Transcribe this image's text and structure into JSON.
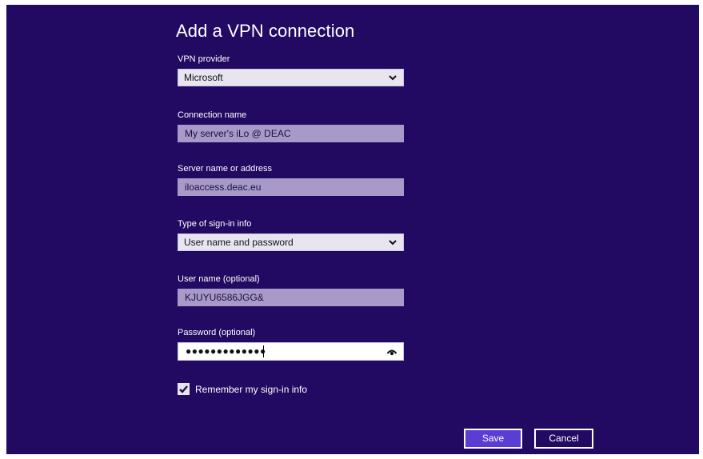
{
  "dialog": {
    "title": "Add a VPN connection",
    "vpn_provider": {
      "label": "VPN provider",
      "value": "Microsoft"
    },
    "connection_name": {
      "label": "Connection name",
      "value": "My server's iLo @ DEAC"
    },
    "server": {
      "label": "Server name or address",
      "value": "iloaccess.deac.eu"
    },
    "sign_in_type": {
      "label": "Type of sign-in info",
      "value": "User name and password"
    },
    "username": {
      "label": "User name (optional)",
      "value": "KJUYU6586JGG&"
    },
    "password": {
      "label": "Password (optional)",
      "value": "●●●●●●●●●●●●●"
    },
    "remember": {
      "label": "Remember my sign-in info",
      "checked": true
    },
    "buttons": {
      "save": "Save",
      "cancel": "Cancel"
    }
  },
  "colors": {
    "background": "#220a63",
    "accent": "#5a3dd2",
    "field_filled": "#a79ac9"
  },
  "icons": {
    "dropdown": "chevron-down-icon",
    "reveal": "eye-icon",
    "check": "checkmark-icon"
  }
}
